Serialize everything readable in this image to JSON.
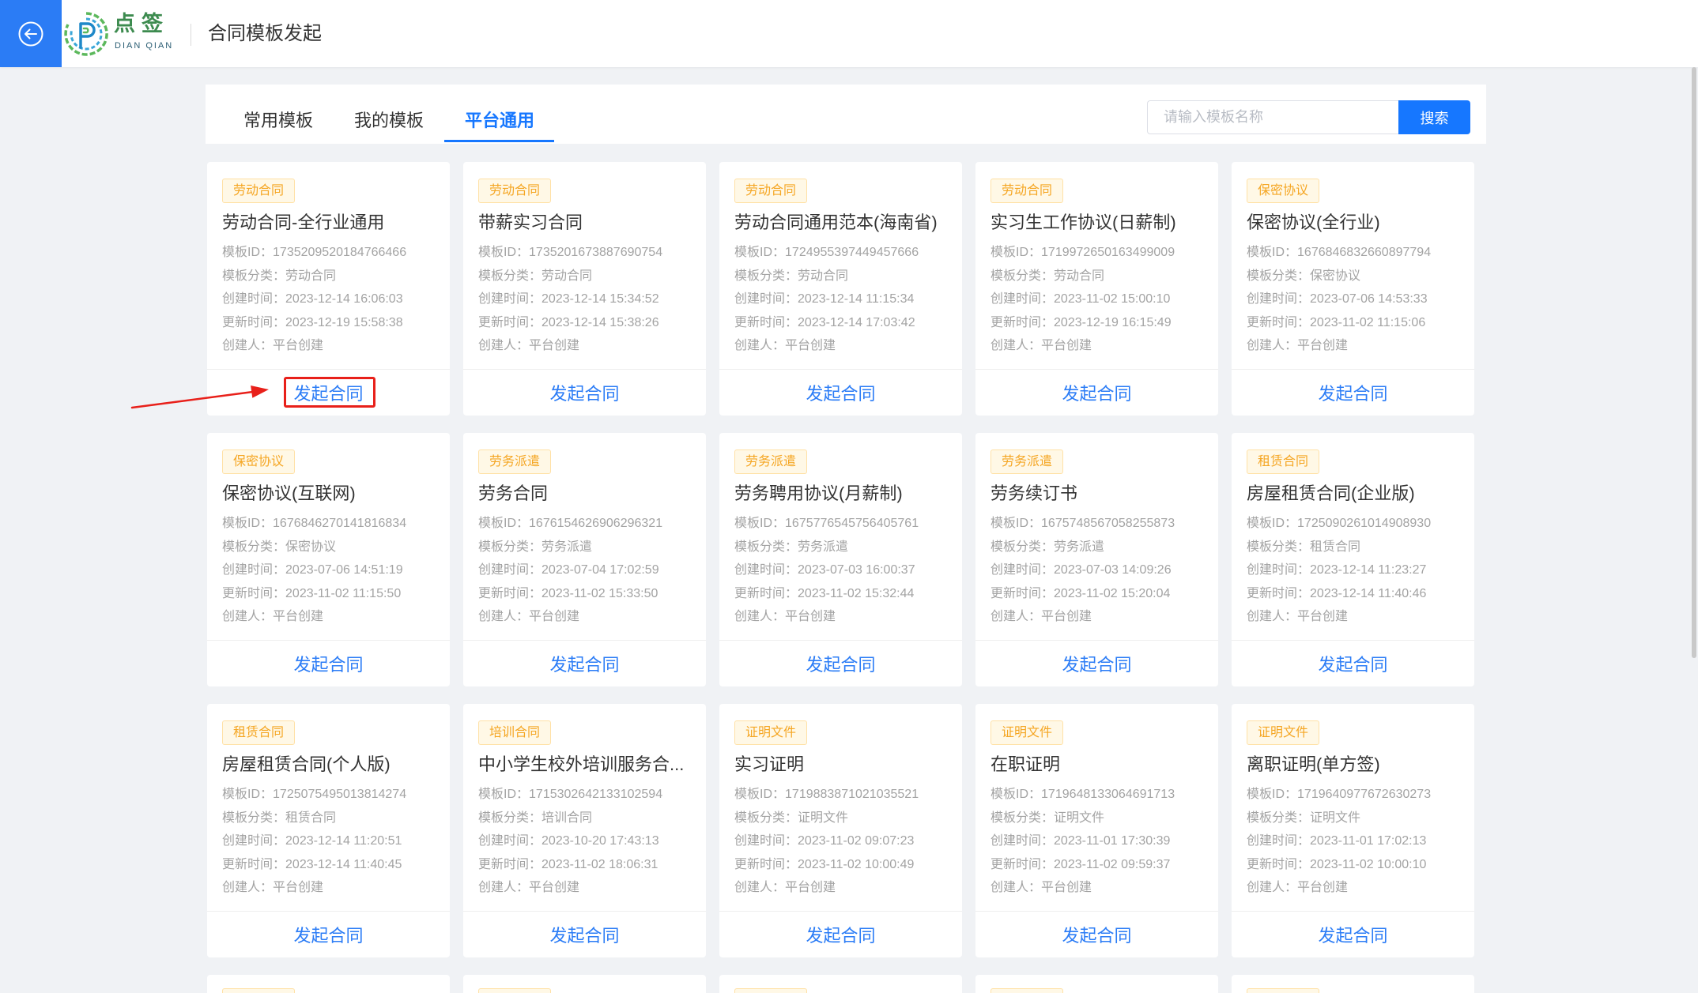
{
  "header": {
    "back_icon": "arrow-left-circle-icon",
    "logo_icon": "dianqian-logo-icon",
    "logo_cn": "点签",
    "logo_en": "DIAN QIAN",
    "title": "合同模板发起"
  },
  "tabs": [
    {
      "label": "常用模板",
      "active": false
    },
    {
      "label": "我的模板",
      "active": false
    },
    {
      "label": "平台通用",
      "active": true
    }
  ],
  "search": {
    "placeholder": "请输入模板名称",
    "value": "",
    "button_label": "搜索"
  },
  "field_labels": {
    "id": "模板ID：",
    "category": "模板分类：",
    "created": "创建时间：",
    "updated": "更新时间：",
    "creator": "创建人："
  },
  "action_label": "发起合同",
  "templates": [
    {
      "tag": "劳动合同",
      "title": "劳动合同-全行业通用",
      "id": "1735209520184766466",
      "category": "劳动合同",
      "created": "2023-12-14 16:06:03",
      "updated": "2023-12-19 15:58:38",
      "creator": "平台创建"
    },
    {
      "tag": "劳动合同",
      "title": "带薪实习合同",
      "id": "1735201673887690754",
      "category": "劳动合同",
      "created": "2023-12-14 15:34:52",
      "updated": "2023-12-14 15:38:26",
      "creator": "平台创建"
    },
    {
      "tag": "劳动合同",
      "title": "劳动合同通用范本(海南省)",
      "id": "1724955397449457666",
      "category": "劳动合同",
      "created": "2023-12-14 11:15:34",
      "updated": "2023-12-14 17:03:42",
      "creator": "平台创建"
    },
    {
      "tag": "劳动合同",
      "title": "实习生工作协议(日薪制)",
      "id": "1719972650163499009",
      "category": "劳动合同",
      "created": "2023-11-02 15:00:10",
      "updated": "2023-12-19 16:15:49",
      "creator": "平台创建"
    },
    {
      "tag": "保密协议",
      "title": "保密协议(全行业)",
      "id": "1676846832660897794",
      "category": "保密协议",
      "created": "2023-07-06 14:53:33",
      "updated": "2023-11-02 11:15:06",
      "creator": "平台创建"
    },
    {
      "tag": "保密协议",
      "title": "保密协议(互联网)",
      "id": "1676846270141816834",
      "category": "保密协议",
      "created": "2023-07-06 14:51:19",
      "updated": "2023-11-02 11:15:50",
      "creator": "平台创建"
    },
    {
      "tag": "劳务派遣",
      "title": "劳务合同",
      "id": "1676154626906296321",
      "category": "劳务派遣",
      "created": "2023-07-04 17:02:59",
      "updated": "2023-11-02 15:33:50",
      "creator": "平台创建"
    },
    {
      "tag": "劳务派遣",
      "title": "劳务聘用协议(月薪制)",
      "id": "1675776545756405761",
      "category": "劳务派遣",
      "created": "2023-07-03 16:00:37",
      "updated": "2023-11-02 15:32:44",
      "creator": "平台创建"
    },
    {
      "tag": "劳务派遣",
      "title": "劳务续订书",
      "id": "1675748567058255873",
      "category": "劳务派遣",
      "created": "2023-07-03 14:09:26",
      "updated": "2023-11-02 15:20:04",
      "creator": "平台创建"
    },
    {
      "tag": "租赁合同",
      "title": "房屋租赁合同(企业版)",
      "id": "1725090261014908930",
      "category": "租赁合同",
      "created": "2023-12-14 11:23:27",
      "updated": "2023-12-14 11:40:46",
      "creator": "平台创建"
    },
    {
      "tag": "租赁合同",
      "title": "房屋租赁合同(个人版)",
      "id": "1725075495013814274",
      "category": "租赁合同",
      "created": "2023-12-14 11:20:51",
      "updated": "2023-12-14 11:40:45",
      "creator": "平台创建"
    },
    {
      "tag": "培训合同",
      "title": "中小学生校外培训服务合...",
      "id": "1715302642133102594",
      "category": "培训合同",
      "created": "2023-10-20 17:43:13",
      "updated": "2023-11-02 18:06:31",
      "creator": "平台创建"
    },
    {
      "tag": "证明文件",
      "title": "实习证明",
      "id": "1719883871021035521",
      "category": "证明文件",
      "created": "2023-11-02 09:07:23",
      "updated": "2023-11-02 10:00:49",
      "creator": "平台创建"
    },
    {
      "tag": "证明文件",
      "title": "在职证明",
      "id": "1719648133064691713",
      "category": "证明文件",
      "created": "2023-11-01 17:30:39",
      "updated": "2023-11-02 09:59:37",
      "creator": "平台创建"
    },
    {
      "tag": "证明文件",
      "title": "离职证明(单方签)",
      "id": "1719640977672630273",
      "category": "证明文件",
      "created": "2023-11-01 17:02:13",
      "updated": "2023-11-02 10:00:10",
      "creator": "平台创建"
    }
  ],
  "colors": {
    "accent": "#1677ff",
    "back_button_bg": "#2b7cf5",
    "action_text": "#2b7cf6",
    "tag_text": "#f5a623",
    "tag_bg": "#fff8e6",
    "tag_border": "#ffe1a6",
    "highlight": "#e8201a",
    "page_bg": "#f0f2f5"
  }
}
